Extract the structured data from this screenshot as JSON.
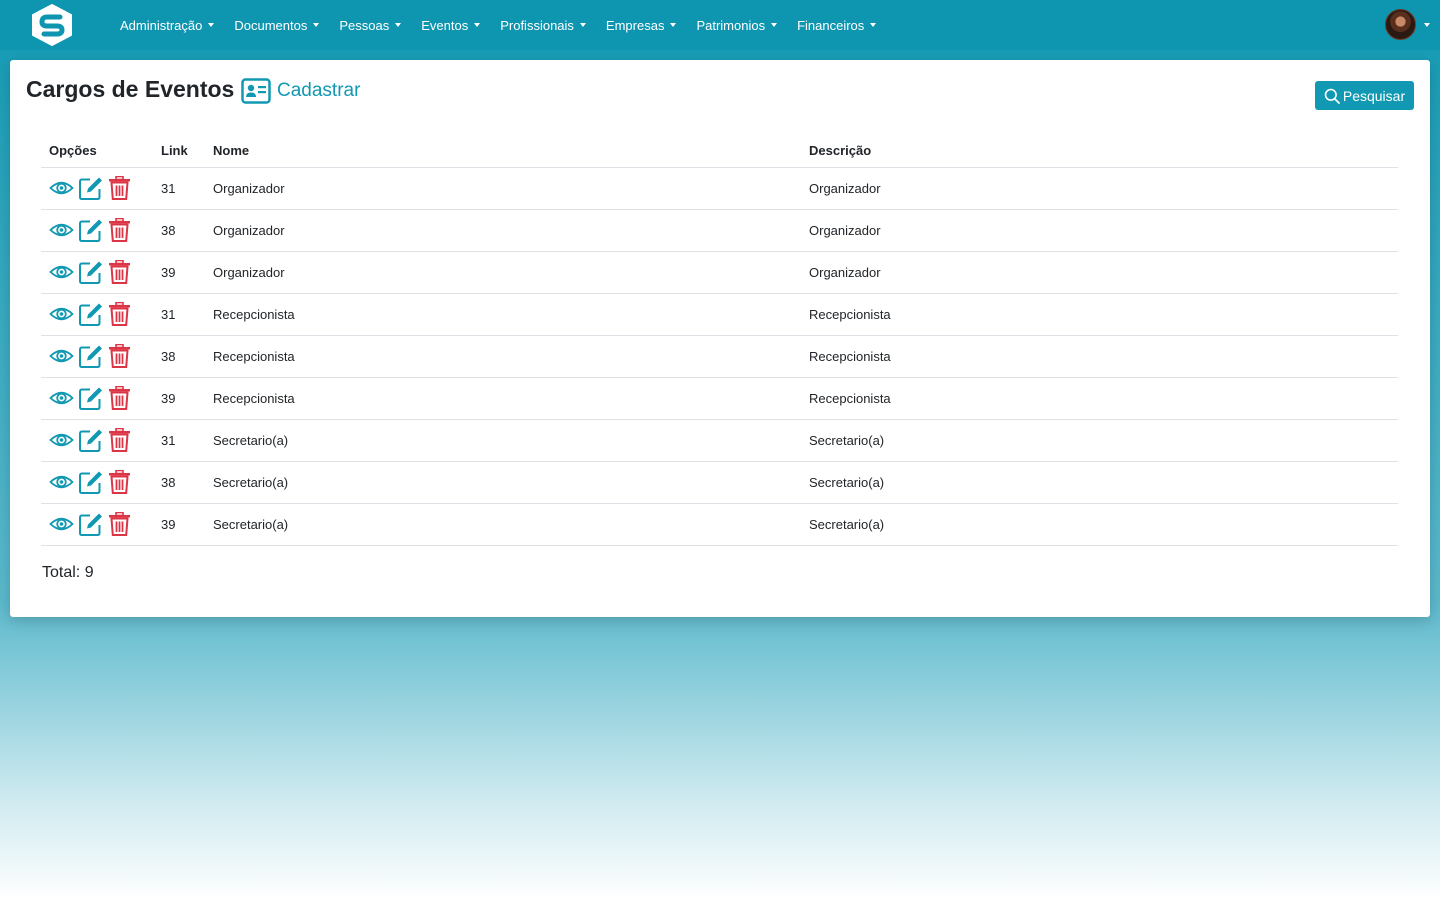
{
  "navbar": {
    "menu": [
      {
        "label": "Administração"
      },
      {
        "label": "Documentos"
      },
      {
        "label": "Pessoas"
      },
      {
        "label": "Eventos"
      },
      {
        "label": "Profissionais"
      },
      {
        "label": "Empresas"
      },
      {
        "label": "Patrimonios"
      },
      {
        "label": "Financeiros"
      }
    ]
  },
  "page": {
    "title": "Cargos de Eventos",
    "create_label": "Cadastrar",
    "search_label": "Pesquisar"
  },
  "table": {
    "headers": {
      "options": "Opções",
      "link": "Link",
      "name": "Nome",
      "description": "Descrição"
    },
    "rows": [
      {
        "link": "31",
        "name": "Organizador",
        "description": "Organizador"
      },
      {
        "link": "38",
        "name": "Organizador",
        "description": "Organizador"
      },
      {
        "link": "39",
        "name": "Organizador",
        "description": "Organizador"
      },
      {
        "link": "31",
        "name": "Recepcionista",
        "description": "Recepcionista"
      },
      {
        "link": "38",
        "name": "Recepcionista",
        "description": "Recepcionista"
      },
      {
        "link": "39",
        "name": "Recepcionista",
        "description": "Recepcionista"
      },
      {
        "link": "31",
        "name": "Secretario(a)",
        "description": "Secretario(a)"
      },
      {
        "link": "38",
        "name": "Secretario(a)",
        "description": "Secretario(a)"
      },
      {
        "link": "39",
        "name": "Secretario(a)",
        "description": "Secretario(a)"
      }
    ],
    "total": "Total: 9"
  },
  "colors": {
    "primary": "#1198b2",
    "navbar": "#0e96b1",
    "danger": "#dc3545"
  },
  "icons": {
    "view": "eye-icon",
    "edit": "edit-icon",
    "delete": "trash-icon",
    "create": "id-card-icon",
    "search": "search-icon"
  }
}
